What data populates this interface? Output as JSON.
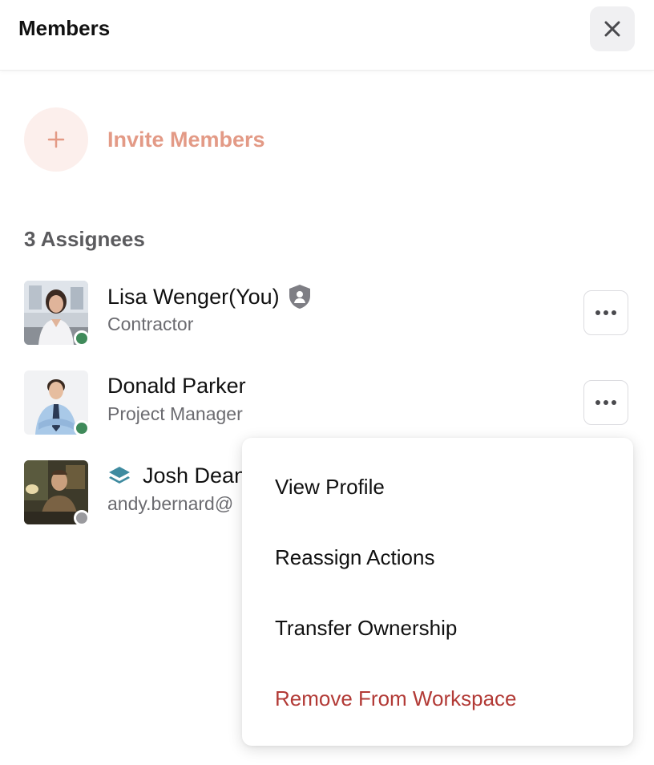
{
  "header": {
    "title": "Members",
    "close_icon": "close-icon"
  },
  "invite": {
    "label": "Invite Members",
    "icon": "plus-icon",
    "color": "#e39a86",
    "bg": "#fcefec"
  },
  "section": {
    "title": "3 Assignees"
  },
  "members": [
    {
      "name": "Lisa Wenger(You)",
      "role": "Contractor",
      "status": "online",
      "status_color": "#3f8a5a",
      "badge": "shield-user-icon"
    },
    {
      "name": "Donald Parker",
      "role": "Project Manager",
      "status": "online",
      "status_color": "#3f8a5a"
    },
    {
      "name": "Josh Dean",
      "role": "andy.bernard@",
      "status": "offline",
      "status_color": "#9a9a9e",
      "badge": "layers-icon"
    }
  ],
  "menu": {
    "items": [
      {
        "label": "View Profile"
      },
      {
        "label": "Reassign Actions"
      },
      {
        "label": "Transfer Ownership"
      },
      {
        "label": "Remove From Workspace",
        "danger": true,
        "color": "#b23a36"
      }
    ]
  }
}
